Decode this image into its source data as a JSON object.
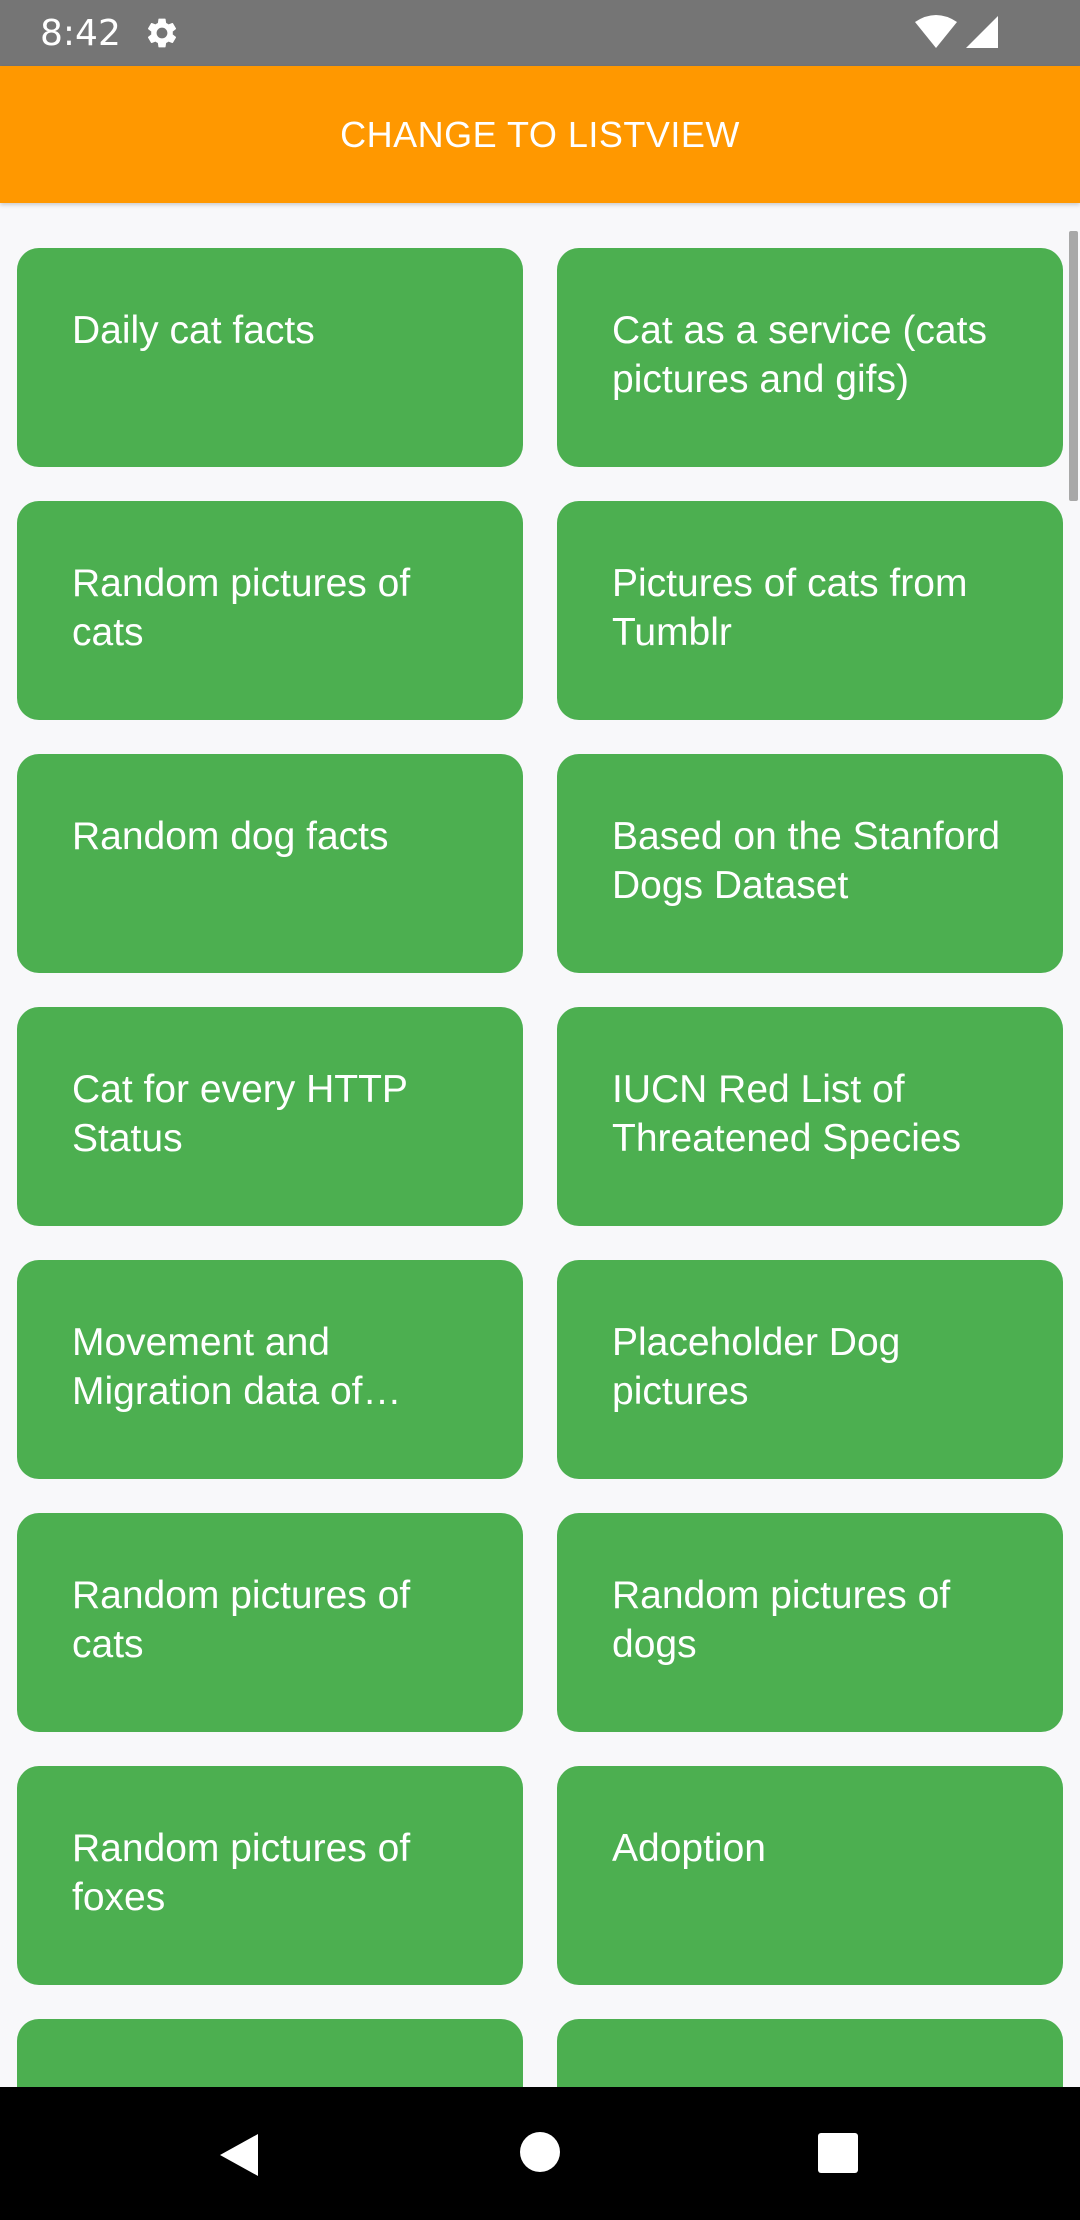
{
  "status_bar": {
    "time": "8:42",
    "icons": [
      "gear-icon",
      "wifi-icon",
      "signal-icon"
    ]
  },
  "header": {
    "button_label": "CHANGE TO LISTVIEW",
    "color": "#ff9800"
  },
  "grid": {
    "card_color": "#4caf50",
    "items": [
      {
        "label": "Daily cat facts"
      },
      {
        "label": "Cat as a service (cats pictures and gifs)"
      },
      {
        "label": "Random pictures of cats"
      },
      {
        "label": "Pictures of cats from Tumblr"
      },
      {
        "label": "Random dog facts"
      },
      {
        "label": "Based on the Stanford Dogs Dataset"
      },
      {
        "label": "Cat for every HTTP Status"
      },
      {
        "label": "IUCN Red List of Threatened Species"
      },
      {
        "label": "Movement and Migration data of animals"
      },
      {
        "label": "Placeholder Dog pictures"
      },
      {
        "label": "Random pictures of cats"
      },
      {
        "label": "Random pictures of dogs"
      },
      {
        "label": "Random pictures of foxes"
      },
      {
        "label": "Adoption"
      },
      {
        "label": ""
      },
      {
        "label": ""
      }
    ]
  },
  "nav_bar": {
    "icons": [
      "back-icon",
      "home-icon",
      "recents-icon"
    ]
  }
}
